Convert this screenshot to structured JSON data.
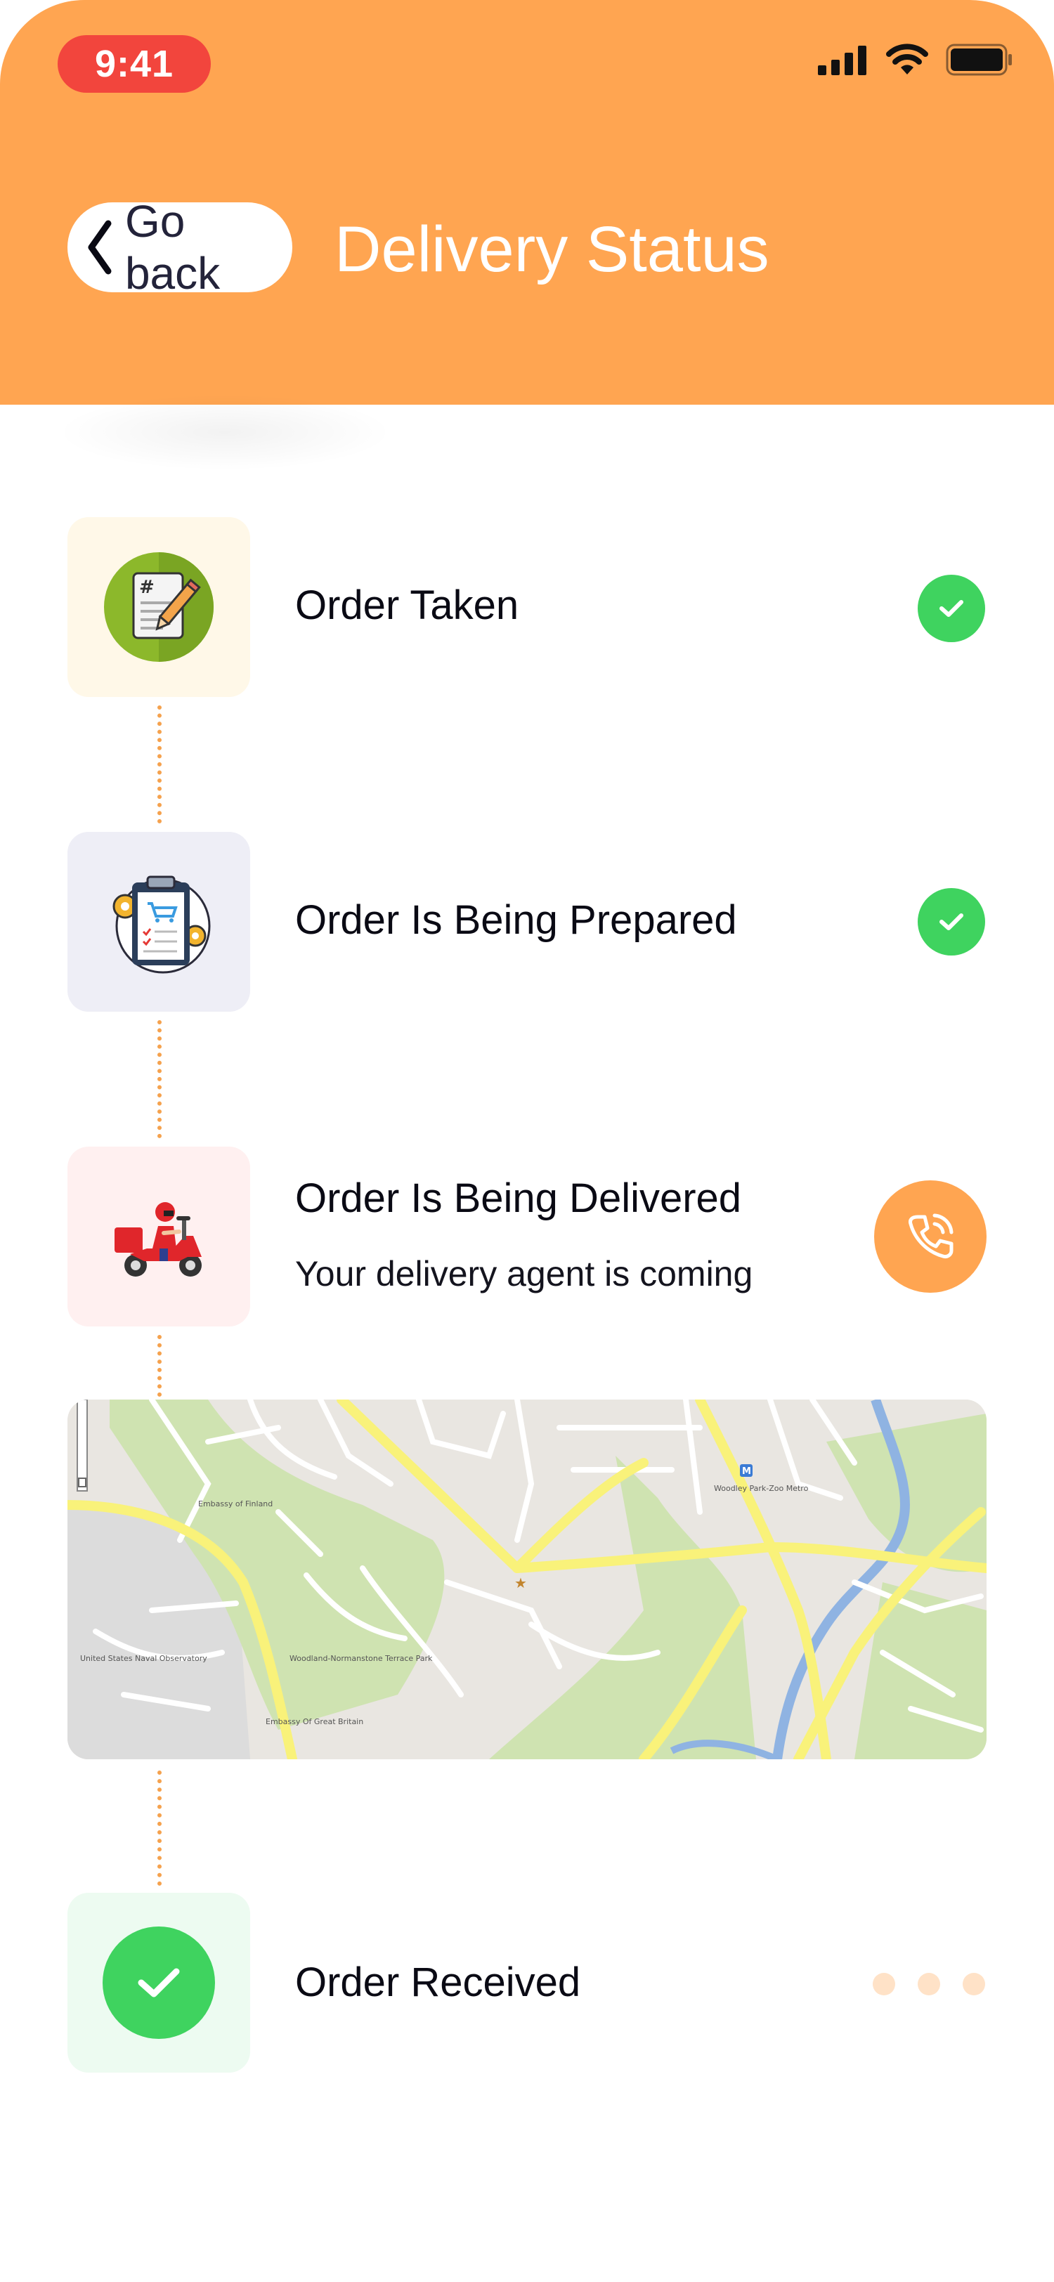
{
  "status_bar": {
    "time": "9:41",
    "icons": [
      "signal-icon",
      "wifi-icon",
      "battery-icon"
    ]
  },
  "header": {
    "back_label": "Go back",
    "title": "Delivery Status",
    "background": "#FFA551"
  },
  "steps": [
    {
      "title": "Order Taken",
      "status": "done",
      "icon": "order-form-icon"
    },
    {
      "title": "Order Is Being Prepared",
      "status": "done",
      "icon": "clipboard-cart-icon"
    },
    {
      "title": "Order Is Being Delivered",
      "subtitle": "Your delivery agent is coming",
      "status": "in-progress",
      "icon": "scooter-courier-icon",
      "action": "phone-icon"
    },
    {
      "title": "Order Received",
      "status": "pending",
      "icon": "check-icon"
    }
  ],
  "map": {
    "labels": [
      "Embassy of Finland",
      "Woodley Park-Zoo Metro",
      "United States Naval Observatory",
      "Woodland-Normanstone Terrace Park",
      "Embassy Of Great Britain"
    ]
  },
  "colors": {
    "accent": "#FFA551",
    "success": "#3FD35F",
    "time_pill": "#F2453D",
    "pending_dot": "#FFE2C7"
  }
}
